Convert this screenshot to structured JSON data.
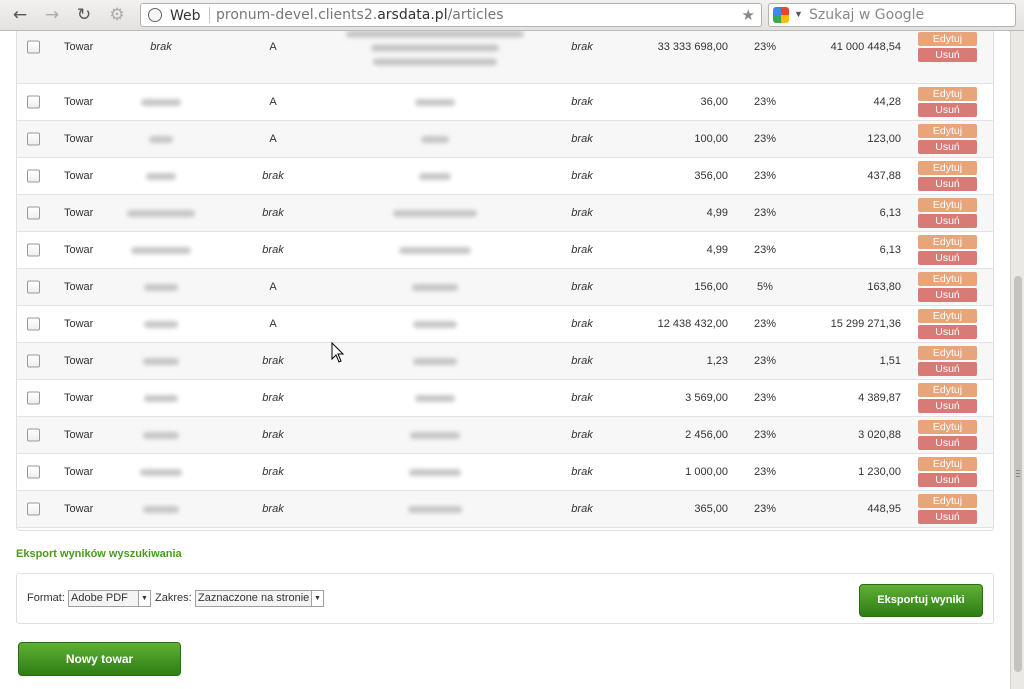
{
  "browser": {
    "back_icon": "arrow-left-icon",
    "forward_icon": "arrow-right-icon",
    "reload_icon": "reload-icon",
    "key_icon": "key-icon",
    "web_label": "Web",
    "url_prefix": "pronum-devel.clients2.",
    "url_domain": "arsdata.pl",
    "url_path": "/articles",
    "search_placeholder": "Szukaj w Google"
  },
  "table": {
    "rows": [
      {
        "type": "Towar",
        "name": "brak",
        "group": "A",
        "unit": "brak",
        "net": "33 333 698,00",
        "vat": "23%",
        "gross": "41 000 448,54",
        "edit": "Edytuj",
        "delete": "Usuń"
      },
      {
        "type": "Towar",
        "name": "",
        "group": "A",
        "unit": "brak",
        "net": "36,00",
        "vat": "23%",
        "gross": "44,28",
        "edit": "Edytuj",
        "delete": "Usuń"
      },
      {
        "type": "Towar",
        "name": "",
        "group": "A",
        "unit": "brak",
        "net": "100,00",
        "vat": "23%",
        "gross": "123,00",
        "edit": "Edytuj",
        "delete": "Usuń"
      },
      {
        "type": "Towar",
        "name": "",
        "group": "brak",
        "unit": "brak",
        "net": "356,00",
        "vat": "23%",
        "gross": "437,88",
        "edit": "Edytuj",
        "delete": "Usuń"
      },
      {
        "type": "Towar",
        "name": "",
        "group": "brak",
        "unit": "brak",
        "net": "4,99",
        "vat": "23%",
        "gross": "6,13",
        "edit": "Edytuj",
        "delete": "Usuń"
      },
      {
        "type": "Towar",
        "name": "",
        "group": "brak",
        "unit": "brak",
        "net": "4,99",
        "vat": "23%",
        "gross": "6,13",
        "edit": "Edytuj",
        "delete": "Usuń"
      },
      {
        "type": "Towar",
        "name": "",
        "group": "A",
        "unit": "brak",
        "net": "156,00",
        "vat": "5%",
        "gross": "163,80",
        "edit": "Edytuj",
        "delete": "Usuń"
      },
      {
        "type": "Towar",
        "name": "",
        "group": "A",
        "unit": "brak",
        "net": "12 438 432,00",
        "vat": "23%",
        "gross": "15 299 271,36",
        "edit": "Edytuj",
        "delete": "Usuń"
      },
      {
        "type": "Towar",
        "name": "",
        "group": "brak",
        "unit": "brak",
        "net": "1,23",
        "vat": "23%",
        "gross": "1,51",
        "edit": "Edytuj",
        "delete": "Usuń"
      },
      {
        "type": "Towar",
        "name": "",
        "group": "brak",
        "unit": "brak",
        "net": "3 569,00",
        "vat": "23%",
        "gross": "4 389,87",
        "edit": "Edytuj",
        "delete": "Usuń"
      },
      {
        "type": "Towar",
        "name": "",
        "group": "brak",
        "unit": "brak",
        "net": "2 456,00",
        "vat": "23%",
        "gross": "3 020,88",
        "edit": "Edytuj",
        "delete": "Usuń"
      },
      {
        "type": "Towar",
        "name": "",
        "group": "brak",
        "unit": "brak",
        "net": "1 000,00",
        "vat": "23%",
        "gross": "1 230,00",
        "edit": "Edytuj",
        "delete": "Usuń"
      },
      {
        "type": "Towar",
        "name": "",
        "group": "brak",
        "unit": "brak",
        "net": "365,00",
        "vat": "23%",
        "gross": "448,95",
        "edit": "Edytuj",
        "delete": "Usuń"
      }
    ]
  },
  "export": {
    "title": "Eksport wyników wyszukiwania",
    "format_label": "Format:",
    "format_value": "Adobe PDF",
    "range_label": "Zakres:",
    "range_value": "Zaznaczone na stronie",
    "export_button": "Eksportuj wyniki"
  },
  "new_item_button": "Nowy towar",
  "colors": {
    "edit": "#e9a57a",
    "delete": "#d87a76",
    "green": "#4a9a22"
  }
}
